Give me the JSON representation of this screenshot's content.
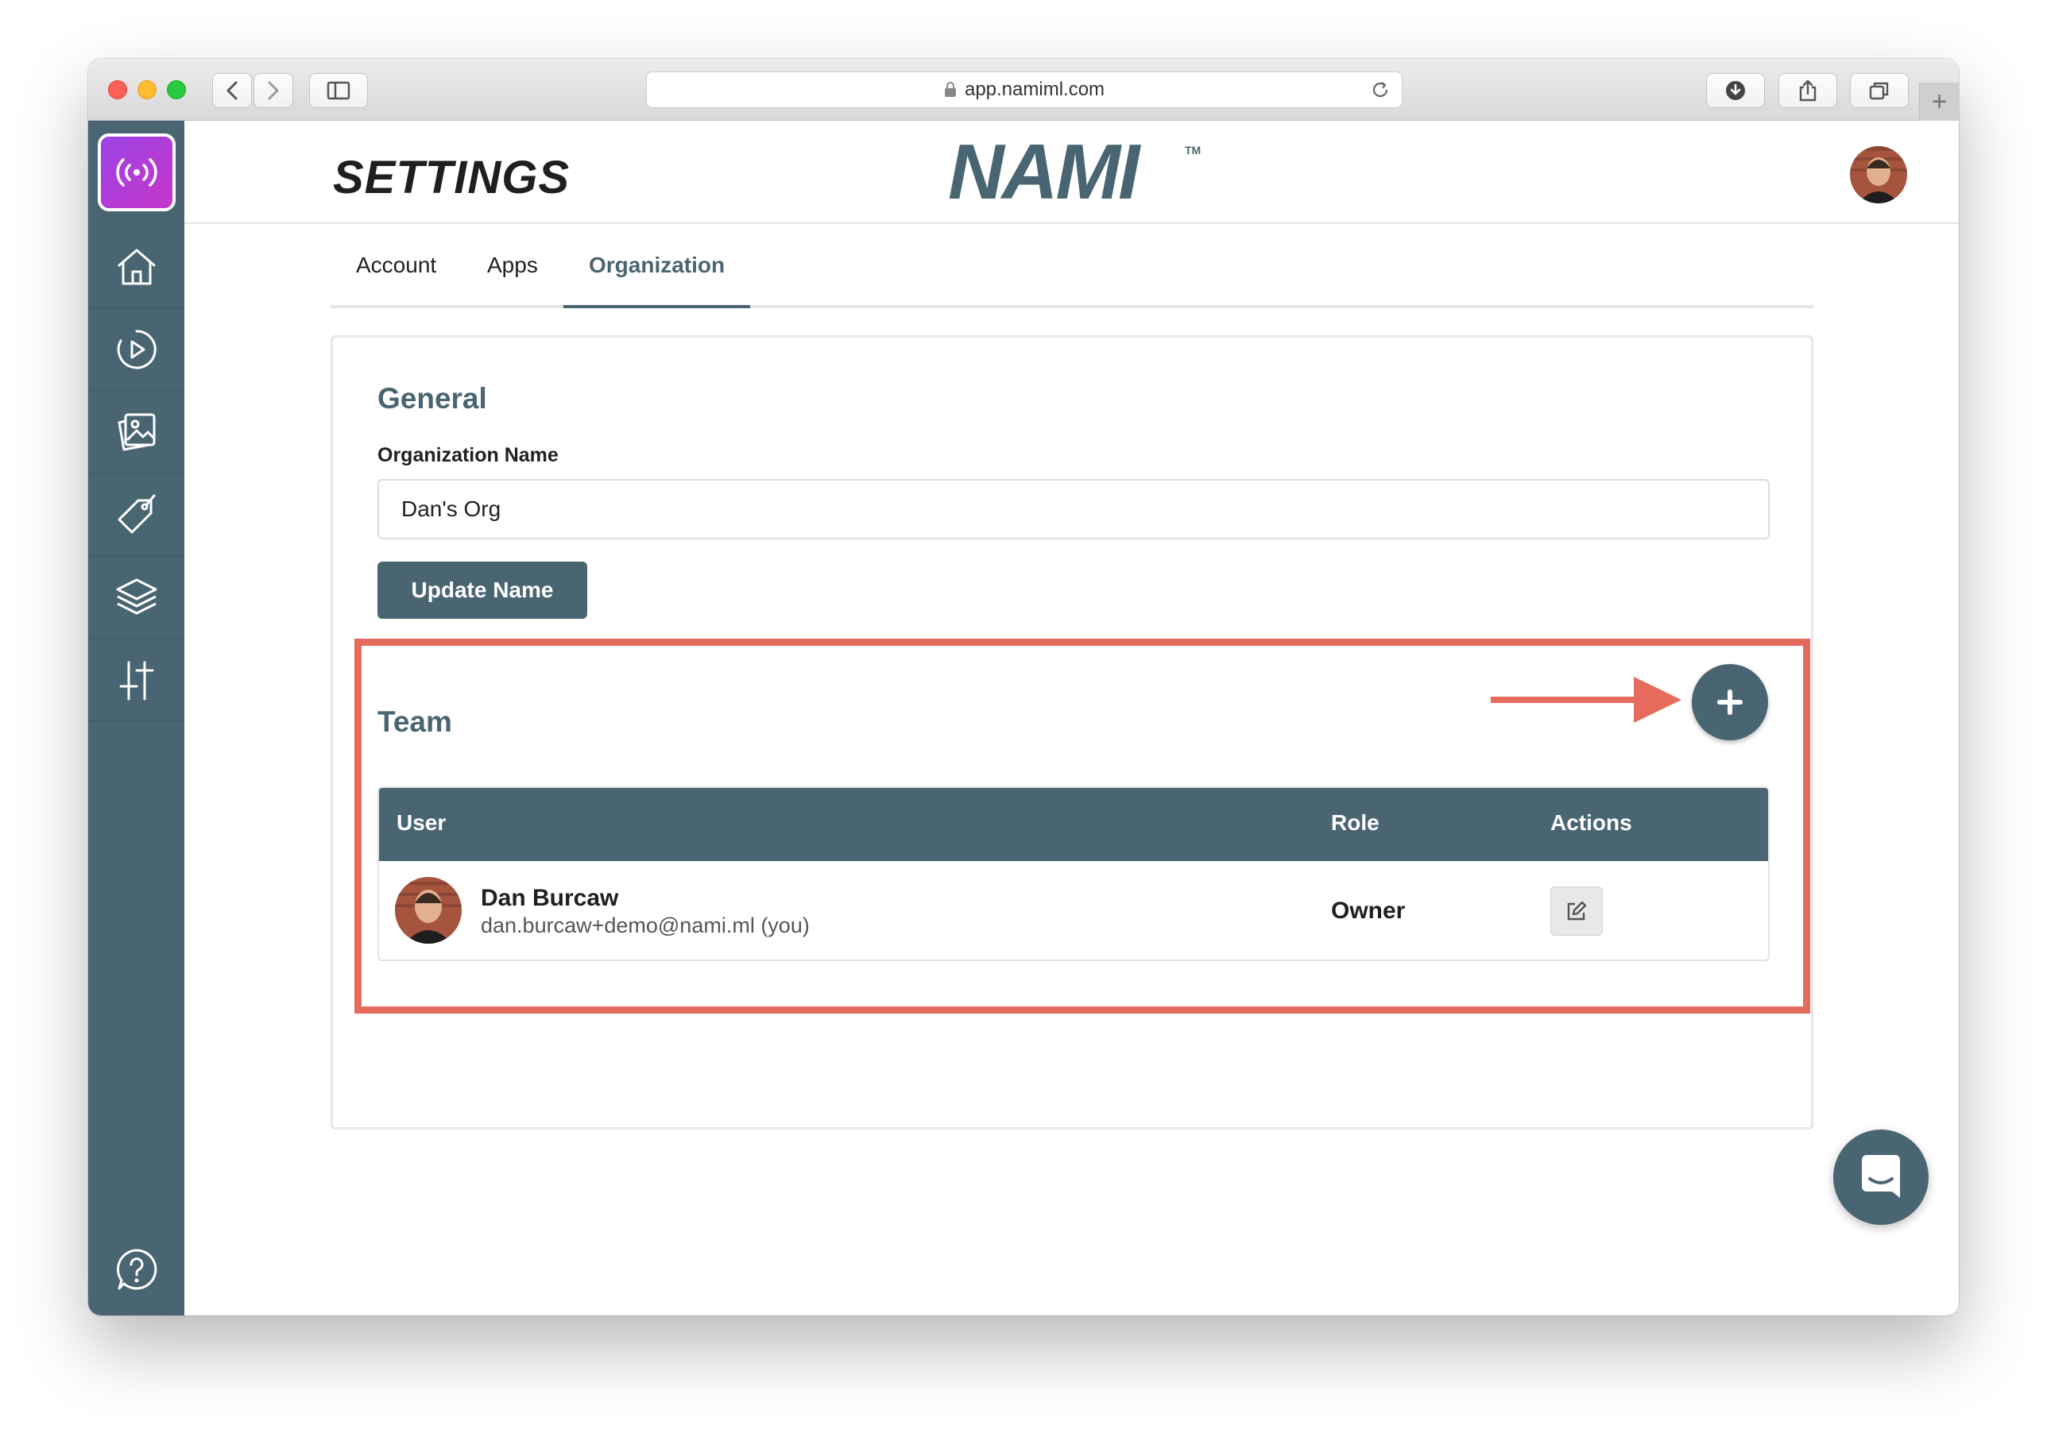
{
  "browser": {
    "url": "app.namiml.com"
  },
  "header": {
    "title": "SETTINGS",
    "brand": "NAMI",
    "trademark": "TM"
  },
  "sidebar": {
    "items": [
      {
        "icon": "home-icon"
      },
      {
        "icon": "play-icon"
      },
      {
        "icon": "gallery-icon"
      },
      {
        "icon": "tag-icon"
      },
      {
        "icon": "layers-icon"
      },
      {
        "icon": "sliders-icon"
      }
    ],
    "help_icon": "help-icon"
  },
  "tabs": [
    {
      "label": "Account",
      "active": false
    },
    {
      "label": "Apps",
      "active": false
    },
    {
      "label": "Organization",
      "active": true
    }
  ],
  "general": {
    "title": "General",
    "org_label": "Organization Name",
    "org_value": "Dan's Org",
    "update_button": "Update Name"
  },
  "team": {
    "title": "Team",
    "columns": [
      "User",
      "Role",
      "Actions"
    ],
    "members": [
      {
        "name": "Dan Burcaw",
        "email": "dan.burcaw+demo@nami.ml (you)",
        "role": "Owner"
      }
    ]
  },
  "colors": {
    "primary": "#4a6572",
    "annotation": "#e56b5d",
    "app_logo": "#b33cd8"
  }
}
